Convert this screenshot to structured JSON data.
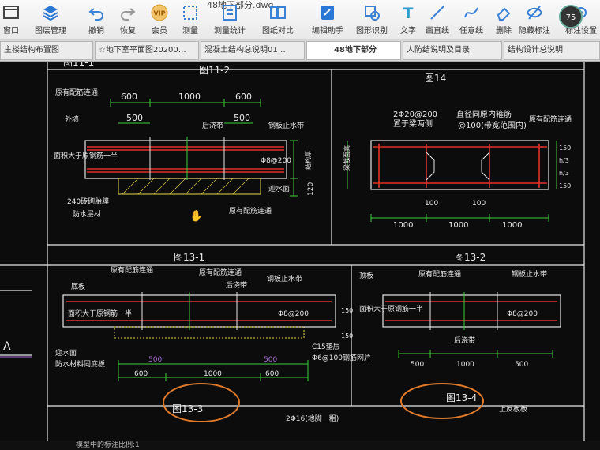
{
  "toolbar": {
    "doc_title": "48地下部分.dwg",
    "tools": [
      {
        "label": "窗口",
        "icon": "window-icon"
      },
      {
        "label": "图层管理",
        "icon": "layers-icon"
      },
      {
        "label": "撤销",
        "icon": "undo-icon"
      },
      {
        "label": "恢复",
        "icon": "redo-icon"
      },
      {
        "label": "会员",
        "icon": "vip-icon"
      },
      {
        "label": "测量",
        "icon": "measure-icon"
      },
      {
        "label": "测量统计",
        "icon": "measure-stats-icon"
      },
      {
        "label": "图纸对比",
        "icon": "drawing-compare-icon"
      },
      {
        "label": "编辑助手",
        "icon": "edit-assistant-icon"
      },
      {
        "label": "图形识别",
        "icon": "shape-recognition-icon"
      },
      {
        "label": "文字",
        "icon": "text-tool-icon"
      },
      {
        "label": "画直线",
        "icon": "draw-line-icon"
      },
      {
        "label": "任意线",
        "icon": "freehand-line-icon"
      },
      {
        "label": "删除",
        "icon": "eraser-icon"
      },
      {
        "label": "隐藏标注",
        "icon": "hide-annotation-icon"
      },
      {
        "label": "标注设置",
        "icon": "annotation-settings-icon"
      }
    ],
    "avatar_text": "75"
  },
  "tabs": [
    {
      "label": "主楼结构布置图"
    },
    {
      "label": "☆地下室平面图20200…"
    },
    {
      "label": "混凝土结构总说明01…"
    },
    {
      "label": "48地下部分",
      "active": true
    },
    {
      "label": "人防结说明及目录"
    },
    {
      "label": "结构设计总说明"
    }
  ],
  "drawing": {
    "titles": {
      "fig11_1": "图11-1",
      "fig11_2": "图11-2",
      "fig14": "图14",
      "fig13_1": "图13-1",
      "fig13_2": "图13-2",
      "fig13_3": "图13-3",
      "fig13_4": "图13-4"
    },
    "fig11_2": {
      "dims_top": [
        "600",
        "1000",
        "600"
      ],
      "dim_500a": "500",
      "dim_500b": "500",
      "dim_h1": "结构厚",
      "dim_h2": "120",
      "rebar_note": "Φ8@200",
      "labels": [
        "原有配筋连通",
        "外墙",
        "后浇带",
        "钢板止水带",
        "面积大于原钢筋一半",
        "240砖砌胎膜",
        "防水层材",
        "迎水面",
        "原有配筋连通"
      ]
    },
    "fig14": {
      "note1": "2Φ20@200",
      "note1b": "置于梁两侧",
      "note2": "直径同原内箍筋",
      "note2b": "@100(带宽范围内)",
      "note3": "原有配筋连通",
      "dim_h": "梁截面高",
      "dims_side": [
        "150",
        "h/3",
        "h/3",
        "150"
      ],
      "dims_top": [
        "100",
        "100"
      ],
      "dims_bottom": [
        "1000",
        "1000",
        "1000"
      ]
    },
    "fig13_1": {
      "labels": [
        "原有配筋连通",
        "原有配筋连通",
        "钢板止水带",
        "后浇带",
        "面积大于原钢筋一半",
        "底板",
        "迎水面",
        "防水材料同底板",
        "C15垫层",
        "Φ6@100钢筋网片"
      ],
      "rebar_note": "Φ8@200",
      "dims_500": [
        "500",
        "500"
      ],
      "dims_600": [
        "600",
        "1000",
        "600"
      ],
      "dims_side": [
        "150",
        "150"
      ]
    },
    "fig13_2": {
      "labels": [
        "顶板",
        "原有配筋连通",
        "钢板止水带",
        "面积大于原钢筋一半",
        "后浇带"
      ],
      "rebar_note": "Φ8@200",
      "dims": [
        "500",
        "1000",
        "500"
      ]
    },
    "left_label": "A",
    "bottom_note": "2Φ16(地脚一粗)",
    "bottom_right_note": "上反板板"
  },
  "status": {
    "text": "模型中的标注比例:1"
  },
  "colors": {
    "line": "#e8e8e8",
    "rebar": "#e0322a",
    "dim": "#3ad13a",
    "label": "#e8e8e8",
    "yellow": "#e8d64a",
    "ink_circle": "#e07a2a"
  }
}
